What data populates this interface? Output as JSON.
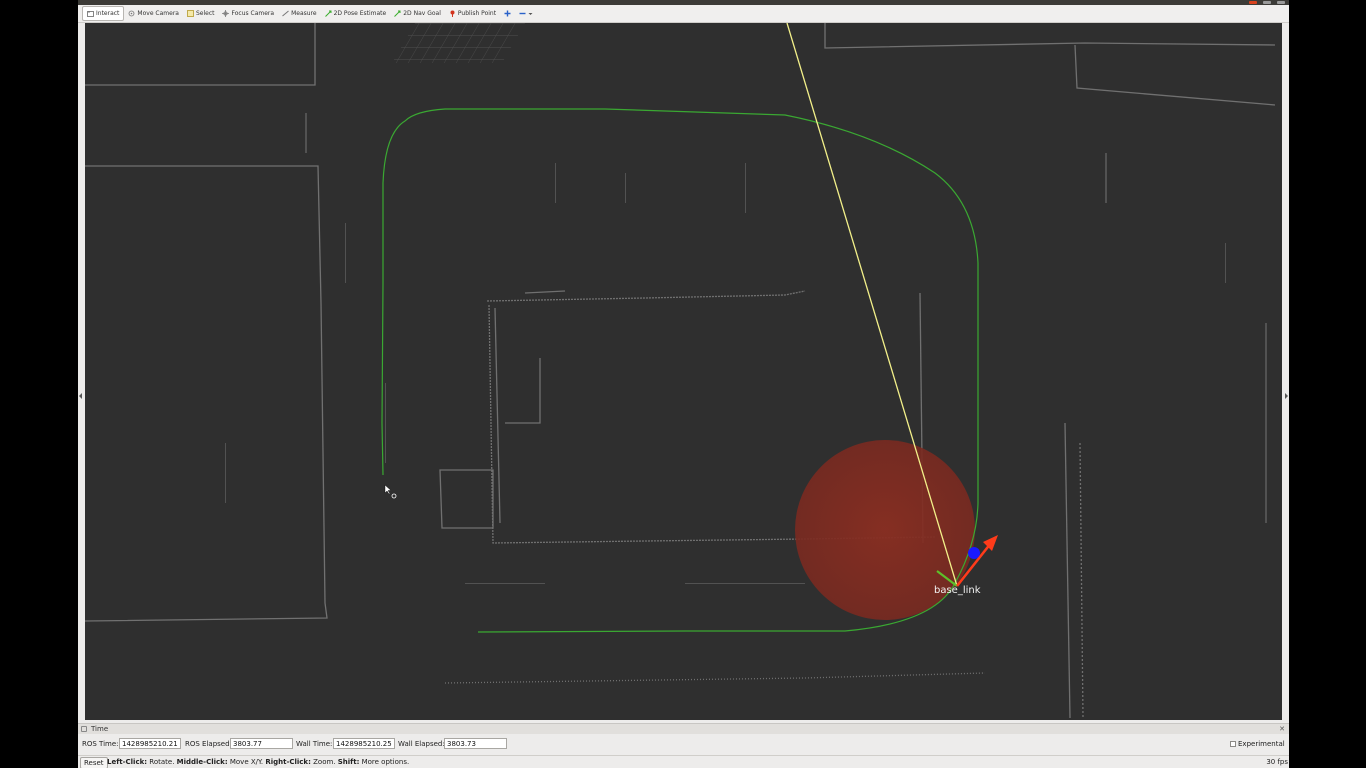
{
  "toolbar": {
    "tools": [
      {
        "label": "Interact",
        "icon": "interact-icon",
        "active": true
      },
      {
        "label": "Move Camera",
        "icon": "move-camera-icon"
      },
      {
        "label": "Select",
        "icon": "select-icon"
      },
      {
        "label": "Focus Camera",
        "icon": "focus-camera-icon"
      },
      {
        "label": "Measure",
        "icon": "measure-icon"
      },
      {
        "label": "2D Pose Estimate",
        "icon": "pose-estimate-arrow-icon"
      },
      {
        "label": "2D Nav Goal",
        "icon": "nav-goal-arrow-icon"
      },
      {
        "label": "Publish Point",
        "icon": "publish-point-pin-icon"
      }
    ]
  },
  "viewport": {
    "frame_label": "base_link",
    "colors": {
      "background": "#2f2f2f",
      "path": "#3aa832",
      "laser_line": "#f3f08a",
      "footprint": "#7a2a20",
      "x_axis": "#ff3b1a",
      "y_axis": "#5ec02a",
      "goal_marker": "#1a1aff"
    }
  },
  "time_panel": {
    "title": "Time",
    "ros_time_label": "ROS Time:",
    "ros_time_value": "1428985210.21",
    "ros_elapsed_label": "ROS Elapsed:",
    "ros_elapsed_value": "3803.77",
    "wall_time_label": "Wall Time:",
    "wall_time_value": "1428985210.25",
    "wall_elapsed_label": "Wall Elapsed:",
    "wall_elapsed_value": "3803.73",
    "experimental_label": "Experimental"
  },
  "statusbar": {
    "reset_label": "Reset",
    "hint_left_click": "Left-Click:",
    "hint_left_action": " Rotate. ",
    "hint_middle_click": "Middle-Click:",
    "hint_middle_action": " Move X/Y. ",
    "hint_right_click": "Right-Click:",
    "hint_right_action": " Zoom. ",
    "hint_shift": "Shift:",
    "hint_shift_action": " More options.",
    "fps": "30 fps"
  }
}
